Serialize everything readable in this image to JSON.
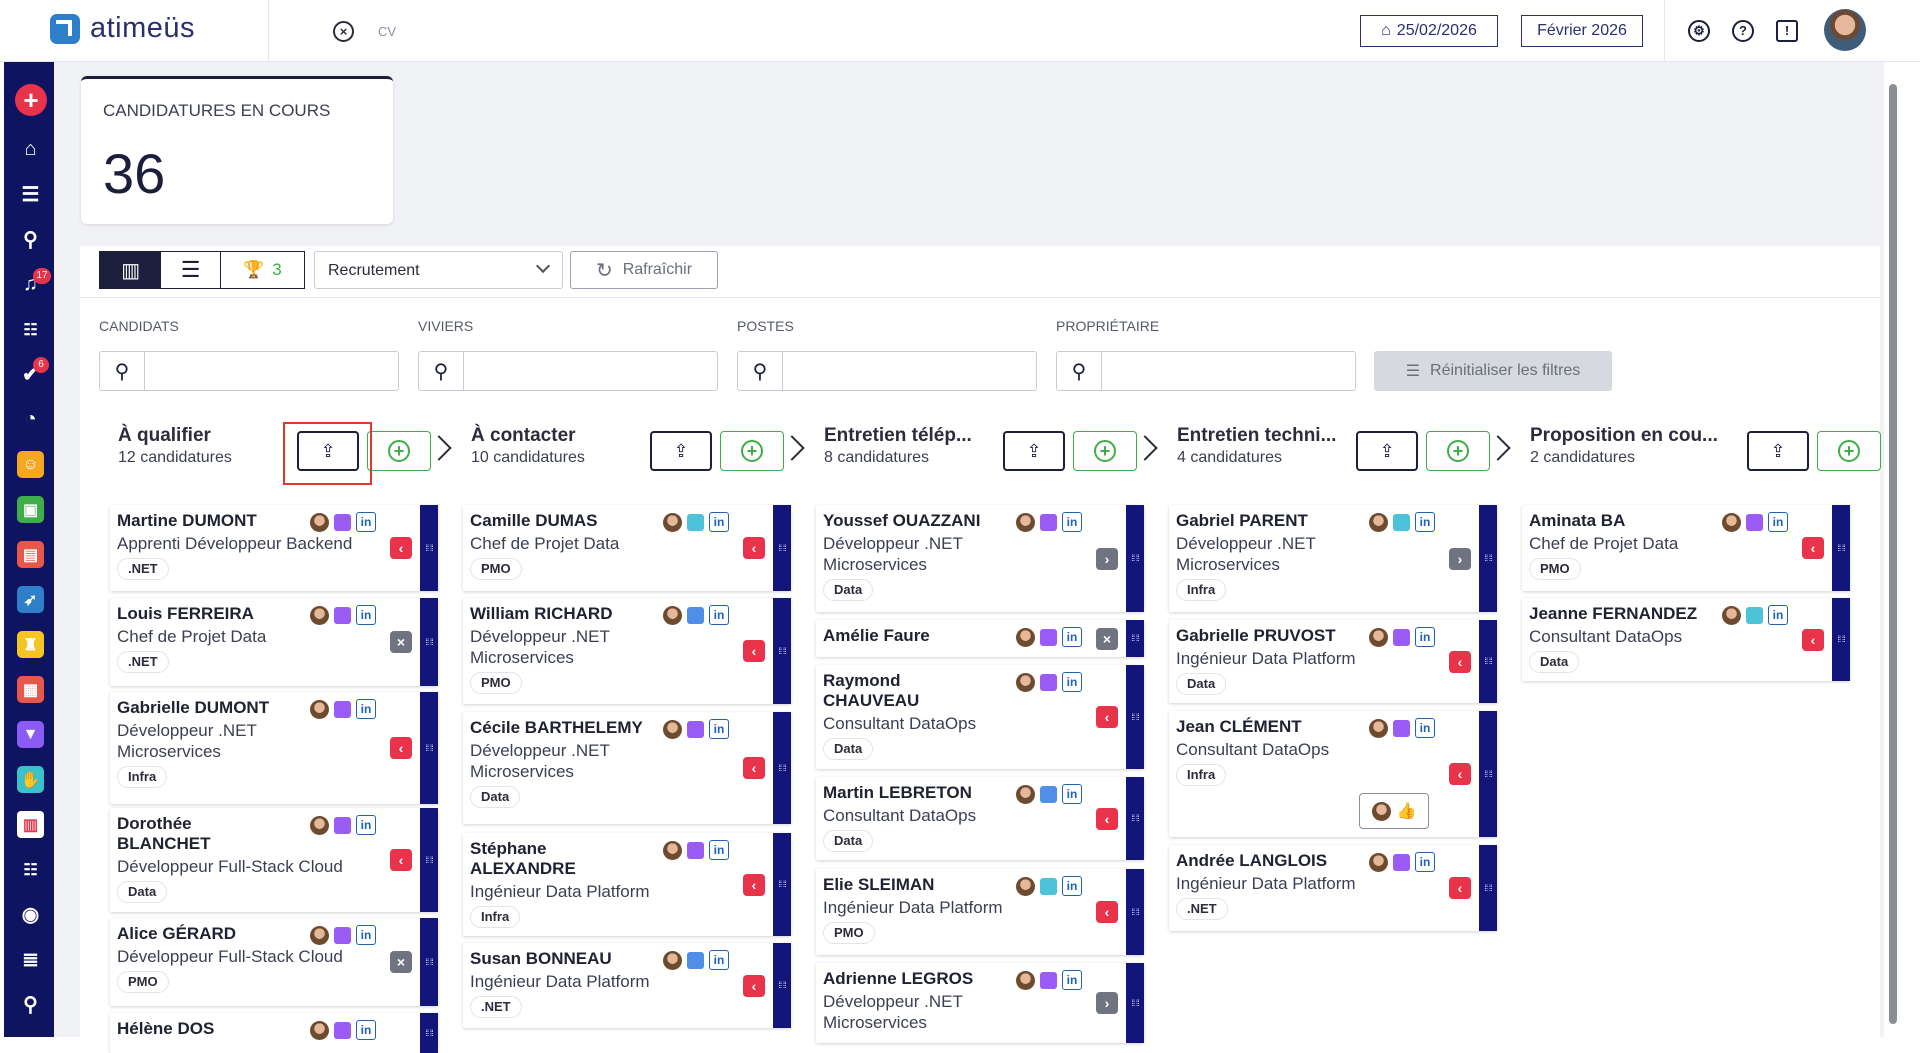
{
  "header": {
    "brand": "atimeüs",
    "tab_label": "CV",
    "date_label": "25/02/2026",
    "month_label": "Février 2026"
  },
  "sidebar": {
    "badges": {
      "notifications": "17",
      "tasks": "6"
    }
  },
  "stat": {
    "label": "CANDIDATURES EN COURS",
    "value": "36"
  },
  "toolbar": {
    "trophy_count": "3",
    "pipeline": "Recrutement",
    "refresh_label": "Rafraîchir",
    "reset_label": "Réinitialiser les filtres"
  },
  "filters": [
    {
      "label": "CANDIDATS"
    },
    {
      "label": "VIVIERS"
    },
    {
      "label": "POSTES"
    },
    {
      "label": "PROPRIÉTAIRE"
    }
  ],
  "columns": [
    {
      "title": "À qualifier",
      "count": "12 candidatures",
      "cards": [
        {
          "name": "Martine DUMONT",
          "role": "Apprenti Développeur Backend",
          "tag": ".NET",
          "dot": "#9b5cf5",
          "action": "back"
        },
        {
          "name": "Louis FERREIRA",
          "role": "Chef de Projet Data",
          "tag": ".NET",
          "dot": "#9b5cf5",
          "action": "remove"
        },
        {
          "name": "Gabrielle DUMONT",
          "role": "Développeur .NET Microservices",
          "tag": "Infra",
          "dot": "#9b5cf5",
          "action": "back"
        },
        {
          "name": "Dorothée BLANCHET",
          "role": "Développeur Full-Stack Cloud",
          "tag": "Data",
          "dot": "#9b5cf5",
          "action": "back"
        },
        {
          "name": "Alice GÉRARD",
          "role": "Développeur Full-Stack Cloud",
          "tag": "PMO",
          "dot": "#9b5cf5",
          "action": "remove"
        },
        {
          "name": "Hélène DOS",
          "role": "",
          "tag": "",
          "dot": "#9b5cf5",
          "action": ""
        }
      ]
    },
    {
      "title": "À contacter",
      "count": "10 candidatures",
      "cards": [
        {
          "name": "Camille DUMAS",
          "role": "Chef de Projet Data",
          "tag": "PMO",
          "dot": "#4cc3d9",
          "action": "back"
        },
        {
          "name": "William RICHARD",
          "role": "Développeur .NET Microservices",
          "tag": "PMO",
          "dot": "#4f8fe8",
          "action": "back"
        },
        {
          "name": "Cécile BARTHELEMY",
          "role": "Développeur .NET Microservices",
          "tag": "Data",
          "dot": "#9b5cf5",
          "action": "back"
        },
        {
          "name": "Stéphane ALEXANDRE",
          "role": "Ingénieur Data Platform",
          "tag": "Infra",
          "dot": "#9b5cf5",
          "action": "back"
        },
        {
          "name": "Susan BONNEAU",
          "role": "Ingénieur Data Platform",
          "tag": ".NET",
          "dot": "#4f8fe8",
          "action": "back"
        }
      ]
    },
    {
      "title": "Entretien télép...",
      "count": "8 candidatures",
      "cards": [
        {
          "name": "Youssef OUAZZANI",
          "role": "Développeur .NET Microservices",
          "tag": "Data",
          "dot": "#9b5cf5",
          "action": "forward"
        },
        {
          "name": "Amélie Faure",
          "role": "",
          "tag": "",
          "dot": "#9b5cf5",
          "action": "remove"
        },
        {
          "name": "Raymond CHAUVEAU",
          "role": "Consultant DataOps",
          "tag": "Data",
          "dot": "#9b5cf5",
          "action": "back"
        },
        {
          "name": "Martin LEBRETON",
          "role": "Consultant DataOps",
          "tag": "Data",
          "dot": "#4f8fe8",
          "action": "back"
        },
        {
          "name": "Elie SLEIMAN",
          "role": "Ingénieur Data Platform",
          "tag": "PMO",
          "dot": "#4cc3d9",
          "action": "back"
        },
        {
          "name": "Adrienne LEGROS",
          "role": "Développeur .NET Microservices",
          "tag": "",
          "dot": "#9b5cf5",
          "action": "forward"
        }
      ]
    },
    {
      "title": "Entretien techni...",
      "count": "4 candidatures",
      "cards": [
        {
          "name": "Gabriel PARENT",
          "role": "Développeur .NET Microservices",
          "tag": "Infra",
          "dot": "#4cc3d9",
          "action": "forward"
        },
        {
          "name": "Gabrielle PRUVOST",
          "role": "Ingénieur Data Platform",
          "tag": "Data",
          "dot": "#9b5cf5",
          "action": "back"
        },
        {
          "name": "Jean CLÉMENT",
          "role": "Consultant DataOps",
          "tag": "Infra",
          "dot": "#9b5cf5",
          "action": "back"
        },
        {
          "name": "Andrée LANGLOIS",
          "role": "Ingénieur Data Platform",
          "tag": ".NET",
          "dot": "#9b5cf5",
          "action": "back"
        }
      ]
    },
    {
      "title": "Proposition en cou...",
      "count": "2 candidatures",
      "cards": [
        {
          "name": "Aminata BA",
          "role": "Chef de Projet Data",
          "tag": "PMO",
          "dot": "#9b5cf5",
          "action": "back"
        },
        {
          "name": "Jeanne FERNANDEZ",
          "role": "Consultant DataOps",
          "tag": "Data",
          "dot": "#4cc3d9",
          "action": "back"
        }
      ]
    }
  ]
}
